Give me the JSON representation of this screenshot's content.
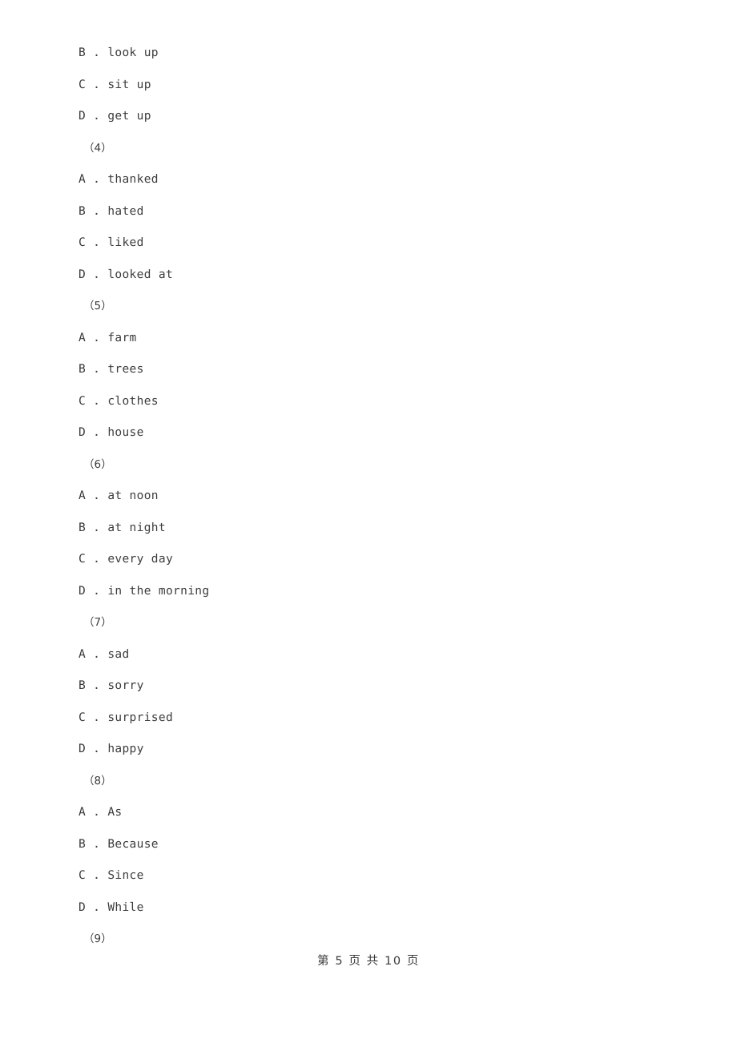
{
  "document": {
    "type": "exam-paper",
    "language": "en-cloze-with-zh-chrome",
    "background_color": "#ffffff",
    "text_color": "#3c3c3c"
  },
  "body_lines": [
    {
      "kind": "option",
      "text": "B . look up"
    },
    {
      "kind": "option",
      "text": "C . sit up"
    },
    {
      "kind": "option",
      "text": "D . get up"
    },
    {
      "kind": "qnum",
      "text": "（4）"
    },
    {
      "kind": "option",
      "text": "A . thanked"
    },
    {
      "kind": "option",
      "text": "B . hated"
    },
    {
      "kind": "option",
      "text": "C . liked"
    },
    {
      "kind": "option",
      "text": "D . looked at"
    },
    {
      "kind": "qnum",
      "text": "（5）"
    },
    {
      "kind": "option",
      "text": "A . farm"
    },
    {
      "kind": "option",
      "text": "B . trees"
    },
    {
      "kind": "option",
      "text": "C . clothes"
    },
    {
      "kind": "option",
      "text": "D . house"
    },
    {
      "kind": "qnum",
      "text": "（6）"
    },
    {
      "kind": "option",
      "text": "A . at noon"
    },
    {
      "kind": "option",
      "text": "B . at night"
    },
    {
      "kind": "option",
      "text": "C . every day"
    },
    {
      "kind": "option",
      "text": "D . in the morning"
    },
    {
      "kind": "qnum",
      "text": "（7）"
    },
    {
      "kind": "option",
      "text": "A . sad"
    },
    {
      "kind": "option",
      "text": "B . sorry"
    },
    {
      "kind": "option",
      "text": "C . surprised"
    },
    {
      "kind": "option",
      "text": "D . happy"
    },
    {
      "kind": "qnum",
      "text": "（8）"
    },
    {
      "kind": "option",
      "text": "A . As"
    },
    {
      "kind": "option",
      "text": "B . Because"
    },
    {
      "kind": "option",
      "text": "C . Since"
    },
    {
      "kind": "option",
      "text": "D . While"
    },
    {
      "kind": "qnum",
      "text": "（9）"
    }
  ],
  "footer": {
    "text": "第 5 页 共 10 页",
    "current_page": "5",
    "total_pages": "10"
  }
}
